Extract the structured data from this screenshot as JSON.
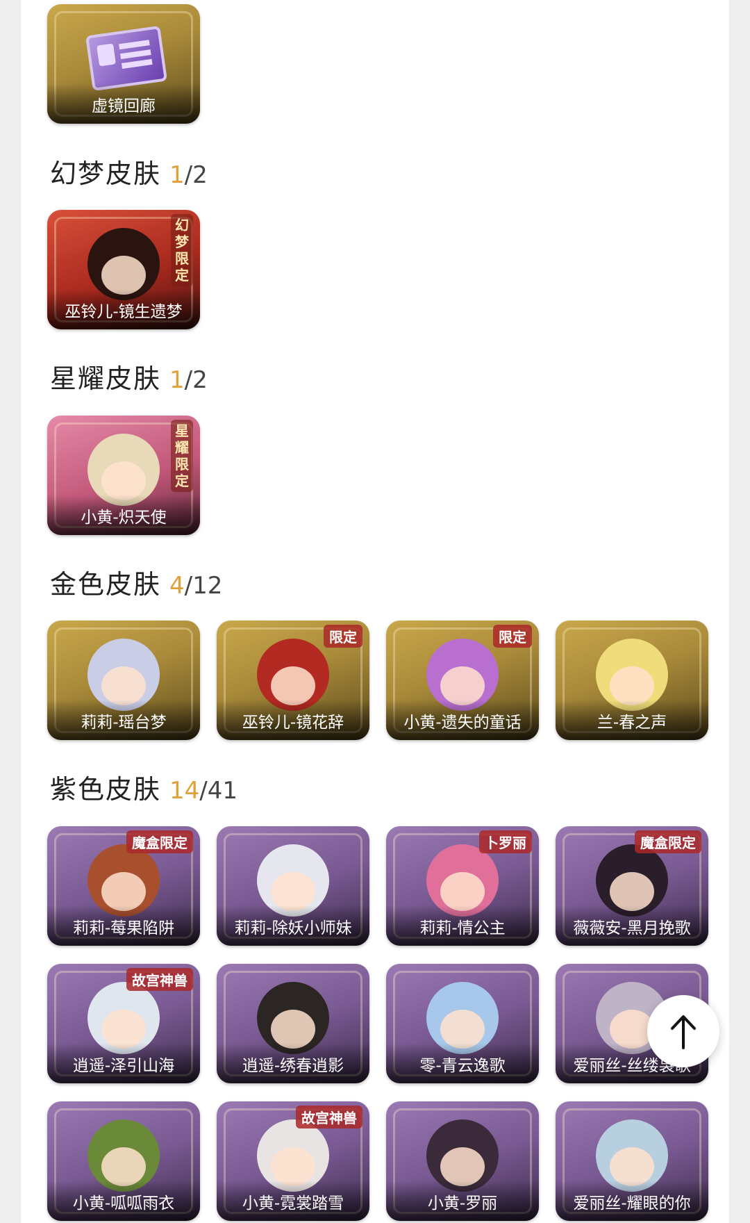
{
  "top_item": {
    "label": "虚镜回廊"
  },
  "sections": [
    {
      "title": "幻梦皮肤",
      "owned": "1",
      "total": "/2",
      "items": [
        {
          "label": "巫铃儿-镜生遗梦",
          "tag": "幻梦限定"
        }
      ]
    },
    {
      "title": "星耀皮肤",
      "owned": "1",
      "total": "/2",
      "items": [
        {
          "label": "小黄-炽天使",
          "tag": "星耀限定"
        }
      ]
    },
    {
      "title": "金色皮肤",
      "owned": "4",
      "total": "/12",
      "items": [
        {
          "label": "莉莉-瑶台梦"
        },
        {
          "label": "巫铃儿-镜花辞",
          "tag": "限定"
        },
        {
          "label": "小黄-遗失的童话",
          "tag": "限定"
        },
        {
          "label": "兰-春之声"
        }
      ]
    },
    {
      "title": "紫色皮肤",
      "owned": "14",
      "total": "/41",
      "items": [
        {
          "label": "莉莉-莓果陷阱",
          "tag": "魔盒限定"
        },
        {
          "label": "莉莉-除妖小师妹"
        },
        {
          "label": "莉莉-情公主",
          "tag": "卜罗丽"
        },
        {
          "label": "薇薇安-黑月挽歌",
          "tag": "魔盒限定"
        },
        {
          "label": "逍遥-泽引山海",
          "tag": "故宫神兽"
        },
        {
          "label": "逍遥-绣春逍影"
        },
        {
          "label": "零-青云逸歌"
        },
        {
          "label": "爱丽丝-丝缕袅歌"
        },
        {
          "label": "小黄-呱呱雨衣"
        },
        {
          "label": "小黄-霓裳踏雪",
          "tag": "故宫神兽"
        },
        {
          "label": "小黄-罗丽"
        },
        {
          "label": "爱丽丝-耀眼的你"
        }
      ]
    }
  ],
  "scroll_top": {
    "icon": "arrow-up-icon"
  }
}
